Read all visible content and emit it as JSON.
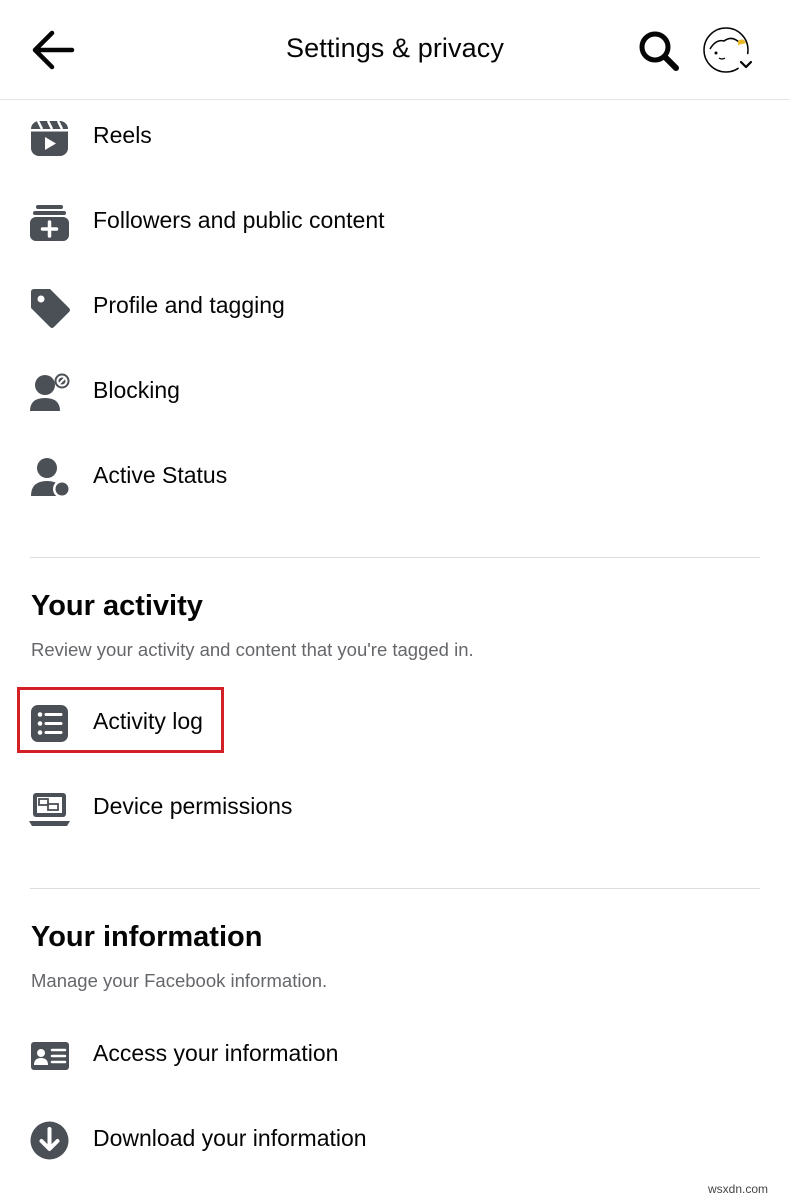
{
  "header": {
    "title": "Settings & privacy"
  },
  "icons": {
    "back": "arrow-left-icon",
    "search": "search-icon",
    "avatar": "profile-avatar"
  },
  "items": [
    {
      "label": "Reels",
      "icon": "reels-icon"
    },
    {
      "label": "Followers and public content",
      "icon": "followers-icon"
    },
    {
      "label": "Profile and tagging",
      "icon": "tag-icon"
    },
    {
      "label": "Blocking",
      "icon": "blocking-icon"
    },
    {
      "label": "Active Status",
      "icon": "active-status-icon"
    }
  ],
  "activity": {
    "title": "Your activity",
    "subtitle": "Review your activity and content that you're tagged in.",
    "items": [
      {
        "label": "Activity log",
        "icon": "list-icon",
        "highlighted": true
      },
      {
        "label": "Device permissions",
        "icon": "laptop-icon"
      }
    ]
  },
  "information": {
    "title": "Your information",
    "subtitle": "Manage your Facebook information.",
    "items": [
      {
        "label": "Access your information",
        "icon": "id-card-icon"
      },
      {
        "label": "Download your information",
        "icon": "download-icon"
      }
    ]
  },
  "colors": {
    "icon": "#4b4f56",
    "highlight": "#d32027",
    "divider": "#dadde1",
    "subtext": "#65676b"
  },
  "watermark": "wsxdn.com"
}
